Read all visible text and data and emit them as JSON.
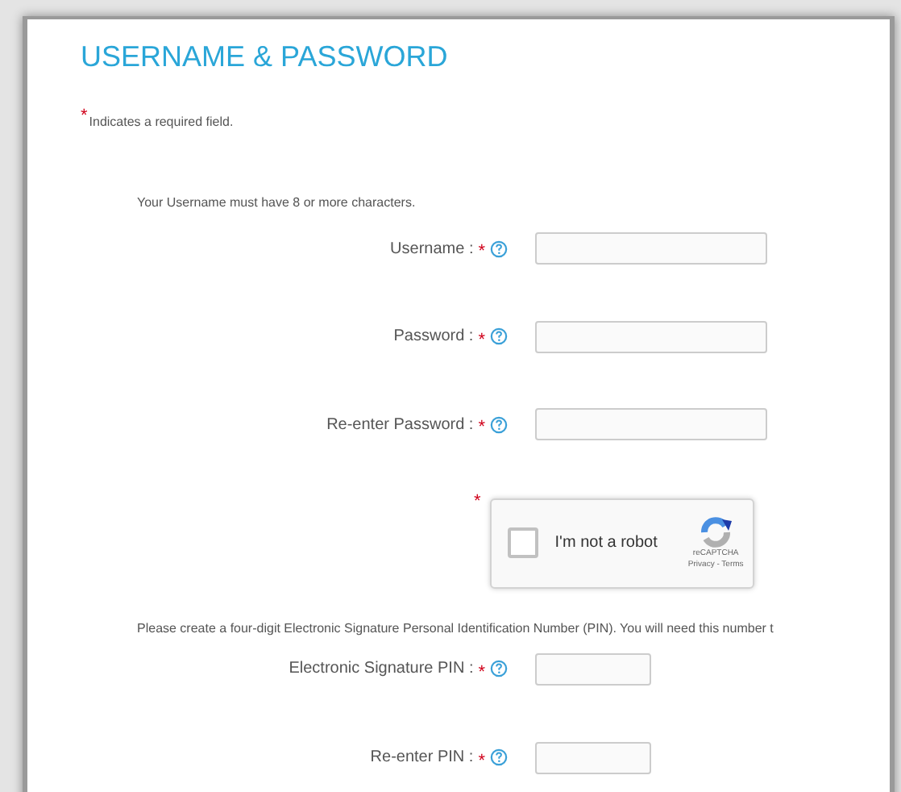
{
  "title": "USERNAME & PASSWORD",
  "required_note": {
    "mark": "*",
    "text": "Indicates a required field."
  },
  "username_note": "Your Username must have 8 or more characters.",
  "account_fields": [
    {
      "label": "Username :",
      "required": true,
      "help": true
    },
    {
      "label": "Password :",
      "required": true,
      "help": true
    },
    {
      "label": "Re-enter Password :",
      "required": true,
      "help": true
    }
  ],
  "captcha": {
    "required": true,
    "checked": false,
    "label": "I'm not a robot",
    "brand": "reCAPTCHA",
    "links": "Privacy - Terms"
  },
  "pin_note": "Please create a four-digit Electronic Signature Personal Identification Number (PIN). You will need this number t",
  "pin_fields": [
    {
      "label": "Electronic Signature PIN :",
      "required": true,
      "help": true
    },
    {
      "label": "Re-enter PIN :",
      "required": true,
      "help": true
    }
  ]
}
